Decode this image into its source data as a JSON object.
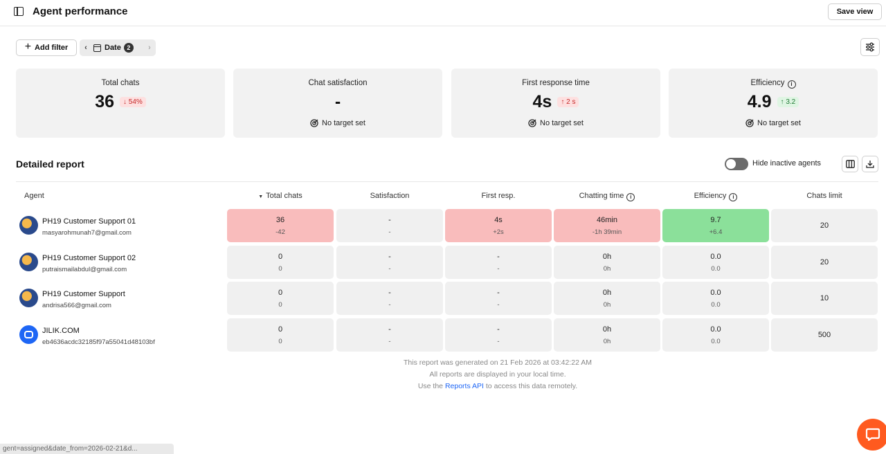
{
  "header": {
    "title": "Agent performance",
    "save_view_label": "Save view"
  },
  "filters": {
    "add_filter_label": "Add filter",
    "date_label": "Date",
    "date_count": "2"
  },
  "stats": [
    {
      "title": "Total chats",
      "value": "36",
      "delta": "54%",
      "delta_dir": "down",
      "target": ""
    },
    {
      "title": "Chat satisfaction",
      "value": "-",
      "delta": "",
      "target": "No target set"
    },
    {
      "title": "First response time",
      "value": "4s",
      "delta": "2 s",
      "delta_dir": "up",
      "target": "No target set"
    },
    {
      "title": "Efficiency",
      "value": "4.9",
      "delta": "3.2",
      "delta_dir": "up",
      "target": "No target set"
    }
  ],
  "report": {
    "title": "Detailed report",
    "hide_inactive_label": "Hide inactive agents",
    "columns": [
      "Agent",
      "Total chats",
      "Satisfaction",
      "First resp.",
      "Chatting time",
      "Efficiency",
      "Chats limit"
    ],
    "rows": [
      {
        "name": "PH19 Customer Support 01",
        "email": "masyarohmunah7@gmail.com",
        "total": "36",
        "total_d": "-42",
        "sat": "-",
        "sat_d": "-",
        "resp": "4s",
        "resp_d": "+2s",
        "chat": "46min",
        "chat_d": "-1h 39min",
        "eff": "9.7",
        "eff_d": "+6.4",
        "limit": "20"
      },
      {
        "name": "PH19 Customer Support 02",
        "email": "putraismailabdul@gmail.com",
        "total": "0",
        "total_d": "0",
        "sat": "-",
        "sat_d": "-",
        "resp": "-",
        "resp_d": "-",
        "chat": "0h",
        "chat_d": "0h",
        "eff": "0.0",
        "eff_d": "0.0",
        "limit": "20"
      },
      {
        "name": "PH19 Customer Support",
        "email": "andrisa566@gmail.com",
        "total": "0",
        "total_d": "0",
        "sat": "-",
        "sat_d": "-",
        "resp": "-",
        "resp_d": "-",
        "chat": "0h",
        "chat_d": "0h",
        "eff": "0.0",
        "eff_d": "0.0",
        "limit": "10"
      },
      {
        "name": "JILIK.COM",
        "email": "eb4636acdc32185f97a55041d48103bf",
        "total": "0",
        "total_d": "0",
        "sat": "-",
        "sat_d": "-",
        "resp": "-",
        "resp_d": "-",
        "chat": "0h",
        "chat_d": "0h",
        "eff": "0.0",
        "eff_d": "0.0",
        "limit": "500"
      }
    ]
  },
  "footer": {
    "generated": "This report was generated on 21 Feb 2026 at 03:42:22 AM",
    "timezone": "All reports are displayed in your local time.",
    "api_prefix": "Use the",
    "api_link": "Reports API",
    "api_suffix": "to access this data remotely."
  },
  "status_url": "gent=assigned&date_from=2026-02-21&d..."
}
